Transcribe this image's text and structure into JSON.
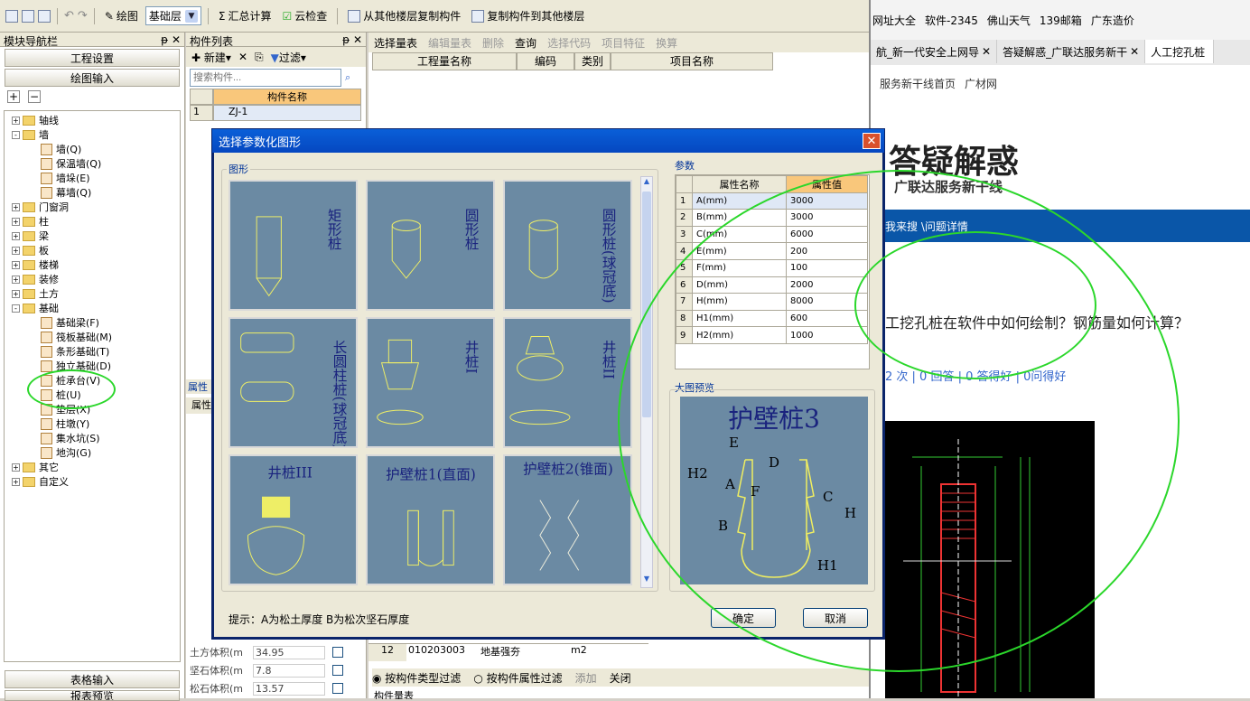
{
  "toolbar": {
    "draw_label": "绘图",
    "floor_label": "基础层",
    "sum_calc_label": "汇总计算",
    "cloud_check_label": "云检查",
    "copy_from_label": "从其他楼层复制构件",
    "copy_to_label": "复制构件到其他楼层"
  },
  "module_nav": {
    "title": "模块导航栏",
    "project_settings": "工程设置",
    "drawing_input": "绘图输入",
    "table_input": "表格输入",
    "report_preview": "报表预览",
    "tree": [
      {
        "label": "轴线",
        "level": 0,
        "expand": "+"
      },
      {
        "label": "墙",
        "level": 0,
        "expand": "-"
      },
      {
        "label": "墙(Q)",
        "level": 1
      },
      {
        "label": "保温墙(Q)",
        "level": 1
      },
      {
        "label": "墙垛(E)",
        "level": 1
      },
      {
        "label": "幕墙(Q)",
        "level": 1
      },
      {
        "label": "门窗洞",
        "level": 0,
        "expand": "+"
      },
      {
        "label": "柱",
        "level": 0,
        "expand": "+"
      },
      {
        "label": "梁",
        "level": 0,
        "expand": "+"
      },
      {
        "label": "板",
        "level": 0,
        "expand": "+"
      },
      {
        "label": "楼梯",
        "level": 0,
        "expand": "+"
      },
      {
        "label": "装修",
        "level": 0,
        "expand": "+"
      },
      {
        "label": "土方",
        "level": 0,
        "expand": "+"
      },
      {
        "label": "基础",
        "level": 0,
        "expand": "-"
      },
      {
        "label": "基础梁(F)",
        "level": 1
      },
      {
        "label": "筏板基础(M)",
        "level": 1
      },
      {
        "label": "条形基础(T)",
        "level": 1
      },
      {
        "label": "独立基础(D)",
        "level": 1
      },
      {
        "label": "桩承台(V)",
        "level": 1
      },
      {
        "label": "桩(U)",
        "level": 1
      },
      {
        "label": "垫层(X)",
        "level": 1
      },
      {
        "label": "柱墩(Y)",
        "level": 1
      },
      {
        "label": "集水坑(S)",
        "level": 1
      },
      {
        "label": "地沟(G)",
        "level": 1
      },
      {
        "label": "其它",
        "level": 0,
        "expand": "+"
      },
      {
        "label": "自定义",
        "level": 0,
        "expand": "+"
      }
    ]
  },
  "component_list": {
    "title": "构件列表",
    "new_label": "新建",
    "filter_label": "过滤",
    "search_placeholder": "搜索构件...",
    "col_header": "构件名称",
    "rows": [
      {
        "index": "1",
        "name": "ZJ-1"
      }
    ],
    "props_tab": "属性",
    "props_header": "属性",
    "props_rows": [
      {
        "name": "土方体积(m",
        "value": "34.95"
      },
      {
        "name": "坚石体积(m",
        "value": "7.8"
      },
      {
        "name": "松石体积(m",
        "value": "13.57"
      }
    ]
  },
  "right_app": {
    "toolbar": [
      "选择量表",
      "编辑量表",
      "删除",
      "查询",
      "选择代码",
      "项目特征",
      "换算"
    ],
    "columns": [
      "工程量名称",
      "编码",
      "类别",
      "项目名称"
    ],
    "bottom_row": {
      "index": "12",
      "code": "010203003",
      "name": "地基强夯",
      "unit": "m2"
    },
    "filter_type": "按构件类型过滤",
    "filter_attr": "按构件属性过滤",
    "add_label": "添加",
    "close_label": "关闭",
    "bottom_tab": "构件量表"
  },
  "browser": {
    "bookmarks": [
      "网址大全",
      "软件-2345",
      "佛山天气",
      "139邮箱",
      "广东造价"
    ],
    "tabs": [
      "航_新一代安全上网导",
      "答疑解惑_广联达服务新干",
      "人工挖孔桩"
    ],
    "nav_links": [
      "服务新干线首页",
      "广材网"
    ],
    "logo_title": "答疑解惑",
    "logo_subtitle": "广联达服务新干线",
    "menu_bar": "我来搜 \\问题详情",
    "question": "工挖孔桩在软件中如何绘制？钢筋量如何计算？",
    "stats": "2 次 | 0 回答 | 0 答得好 | 0问得好"
  },
  "dialog": {
    "title": "选择参数化图形",
    "shapes_group": "图形",
    "params_group": "参数",
    "preview_group": "大图预览",
    "shapes": [
      "矩形桩",
      "圆形桩",
      "圆形桩(球冠底)",
      "长圆柱桩(球冠底)",
      "井桩I",
      "井桩II",
      "井桩III",
      "护壁桩1(直面)",
      "护壁桩2(锥面)"
    ],
    "param_columns": [
      "属性名称",
      "属性值"
    ],
    "params": [
      {
        "i": "1",
        "name": "A(mm)",
        "value": "3000"
      },
      {
        "i": "2",
        "name": "B(mm)",
        "value": "3000"
      },
      {
        "i": "3",
        "name": "C(mm)",
        "value": "6000"
      },
      {
        "i": "4",
        "name": "E(mm)",
        "value": "200"
      },
      {
        "i": "5",
        "name": "F(mm)",
        "value": "100"
      },
      {
        "i": "6",
        "name": "D(mm)",
        "value": "2000"
      },
      {
        "i": "7",
        "name": "H(mm)",
        "value": "8000"
      },
      {
        "i": "8",
        "name": "H1(mm)",
        "value": "600"
      },
      {
        "i": "9",
        "name": "H2(mm)",
        "value": "1000"
      }
    ],
    "preview_title": "护壁桩3",
    "hint": "提示：A为松土厚度  B为松次坚石厚度",
    "ok_label": "确定",
    "cancel_label": "取消"
  },
  "colors": {
    "tile_bg": "#6b8aa3",
    "highlight_circle": "#2bd72b",
    "title_bar": "#0547c0",
    "web_banner": "#0a56a8"
  }
}
